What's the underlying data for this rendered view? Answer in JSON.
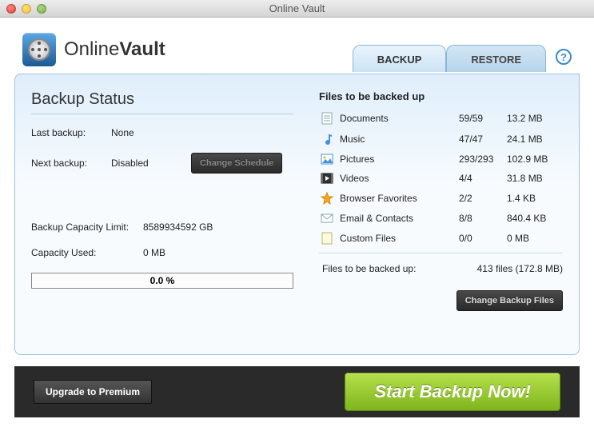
{
  "window": {
    "title": "Online Vault"
  },
  "brand": {
    "name_light": "Online",
    "name_bold": "Vault"
  },
  "tabs": {
    "backup": "BACKUP",
    "restore": "RESTORE"
  },
  "help_glyph": "?",
  "status": {
    "title": "Backup Status",
    "last_label": "Last backup:",
    "last_value": "None",
    "next_label": "Next backup:",
    "next_value": "Disabled",
    "change_schedule": "Change Schedule"
  },
  "capacity": {
    "limit_label": "Backup Capacity Limit:",
    "limit_value": "8589934592 GB",
    "used_label": "Capacity Used:",
    "used_value": "0 MB",
    "progress_text": "0.0 %"
  },
  "files": {
    "title": "Files to be backed up",
    "items": [
      {
        "icon": "doc",
        "name": "Documents",
        "count": "59/59",
        "size": "13.2 MB"
      },
      {
        "icon": "music",
        "name": "Music",
        "count": "47/47",
        "size": "24.1 MB"
      },
      {
        "icon": "pic",
        "name": "Pictures",
        "count": "293/293",
        "size": "102.9 MB"
      },
      {
        "icon": "video",
        "name": "Videos",
        "count": "4/4",
        "size": "31.8 MB"
      },
      {
        "icon": "star",
        "name": "Browser Favorites",
        "count": "2/2",
        "size": "1.4 KB"
      },
      {
        "icon": "mail",
        "name": "Email & Contacts",
        "count": "8/8",
        "size": "840.4 KB"
      },
      {
        "icon": "file",
        "name": "Custom Files",
        "count": "0/0",
        "size": "0 MB"
      }
    ],
    "summary_label": "Files to be backed up:",
    "summary_value": "413 files (172.8 MB)",
    "change_files": "Change Backup Files"
  },
  "footer": {
    "upgrade": "Upgrade to Premium",
    "start": "Start Backup Now!"
  }
}
